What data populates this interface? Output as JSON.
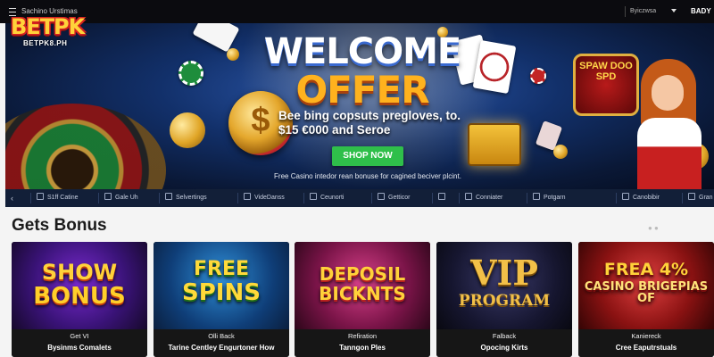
{
  "topbar": {
    "site_label": "Sachino Urstimas",
    "language": "Byiczwsa",
    "user_label": "BADY",
    "logo_text": "BETPK",
    "logo_domain": "BETPK8.PH"
  },
  "hero": {
    "headline_1": "WELCOME",
    "headline_2": "OFFER",
    "coin_symbol": "$",
    "subline": "Bee bing copsuts pregloves, to. $15 €000 and Seroe",
    "cta_label": "SHOP NOW",
    "note": "Free Casino intedor rean bonuse for cagined beciver plcint.",
    "slot_sign": "SPAW DOO SPD"
  },
  "categories": [
    {
      "label": "S1ff Catine",
      "icon": "grid-icon"
    },
    {
      "label": "Gale Uh",
      "icon": "card-icon"
    },
    {
      "label": "Selvertings",
      "icon": "hand-icon"
    },
    {
      "label": "VideDanss",
      "icon": "play-icon"
    },
    {
      "label": "Ceunorti",
      "icon": "table-icon"
    },
    {
      "label": "Getticor",
      "icon": "ring-icon"
    },
    {
      "label": "",
      "icon": "lock-icon"
    },
    {
      "label": "Conniater",
      "icon": "list-icon"
    },
    {
      "label": "Potgarn",
      "icon": "gear-icon"
    },
    {
      "label": "Canobibir",
      "icon": "sparkle-icon"
    },
    {
      "label": "Gran",
      "icon": "star-icon"
    }
  ],
  "section": {
    "title": "Gets Bonus",
    "pager": "● ●"
  },
  "promos": [
    {
      "art_1": "SHOW",
      "art_2": "BONUS",
      "tag": "Get VI",
      "caption": "Bysinms Comalets"
    },
    {
      "art_1": "FREE",
      "art_2": "SPINS",
      "tag": "Olli Back",
      "caption": "Tarine Centley Engurtoner How"
    },
    {
      "art_1": "DEPOSIL",
      "art_2": "BICKNTS",
      "tag": "Refiration",
      "caption": "Tanngon Ples"
    },
    {
      "art_1": "VIP",
      "art_2": "PROGRAM",
      "tag": "Falback",
      "caption": "Opocing Kirts"
    },
    {
      "art_1": "FREA 4%",
      "art_2": "CASINO BRIGEPIAS OF",
      "tag": "Kaniereck",
      "caption": "Cree Eaputrstuals"
    }
  ],
  "colors": {
    "topbar": "#0b0b0f",
    "hero_blue": "#12306a",
    "cta_green": "#2fbf4a",
    "offer_gold": "#ffb21e",
    "category_bar": "#081630"
  }
}
